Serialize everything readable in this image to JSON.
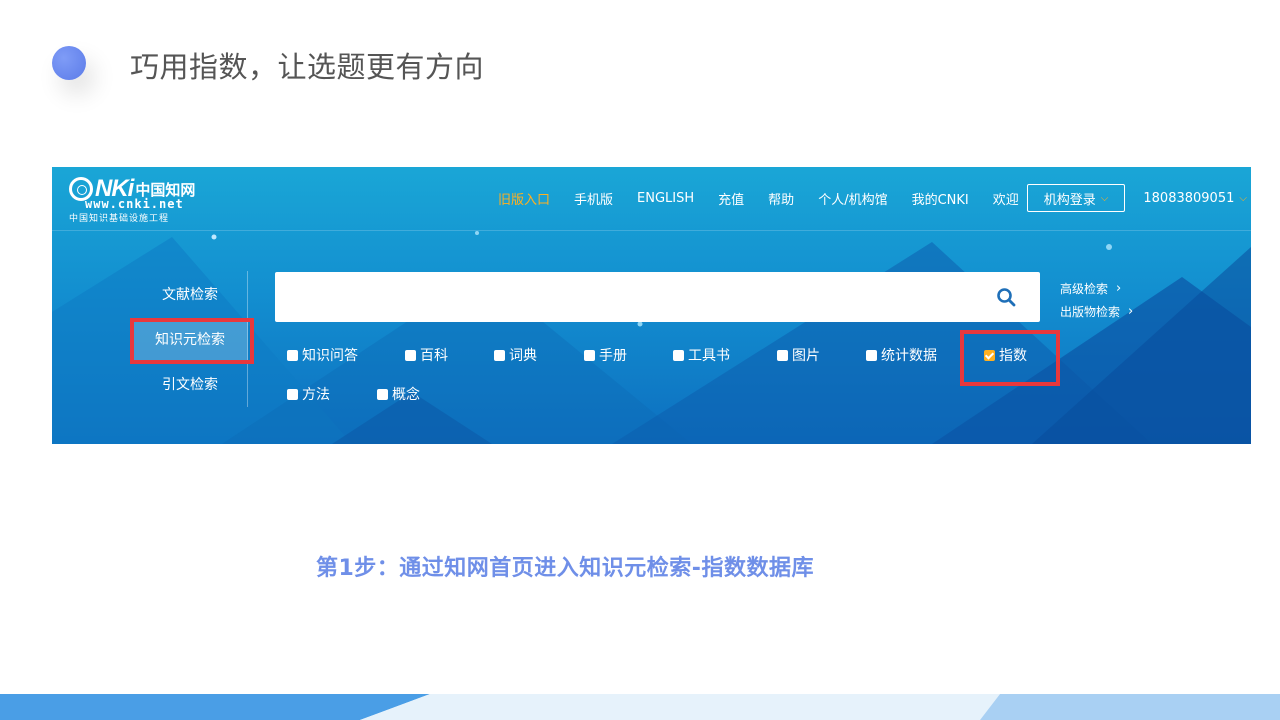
{
  "slide": {
    "title": "巧用指数，让选题更有方向",
    "caption": "第1步：通过知网首页进入知识元检索-指数数据库"
  },
  "logo": {
    "main": "NKi",
    "cn": "中国知网",
    "url": "www.cnki.net",
    "sub": "中国知识基础设施工程"
  },
  "nav": {
    "old_entry": "旧版入口",
    "mobile": "手机版",
    "english": "ENGLISH",
    "recharge": "充值",
    "help": "帮助",
    "personal": "个人/机构馆",
    "my_cnki": "我的CNKI",
    "welcome": "欢迎",
    "login": "机构登录",
    "user": "18083809051"
  },
  "tabs": {
    "literature": "文献检索",
    "knowledge": "知识元检索",
    "citation": "引文检索"
  },
  "search": {
    "value": "",
    "placeholder": ""
  },
  "links": {
    "advanced": "高级检索",
    "publication": "出版物检索"
  },
  "options": [
    {
      "label": "知识问答",
      "checked": false
    },
    {
      "label": "百科",
      "checked": false
    },
    {
      "label": "词典",
      "checked": false
    },
    {
      "label": "手册",
      "checked": false
    },
    {
      "label": "工具书",
      "checked": false
    },
    {
      "label": "图片",
      "checked": false
    },
    {
      "label": "统计数据",
      "checked": false
    },
    {
      "label": "指数",
      "checked": true
    },
    {
      "label": "方法",
      "checked": false
    },
    {
      "label": "概念",
      "checked": false
    }
  ],
  "colors": {
    "highlight": "#e8383d",
    "accent": "#ffb020",
    "caption": "#6f8fe8",
    "search_icon": "#1e6fb8"
  }
}
